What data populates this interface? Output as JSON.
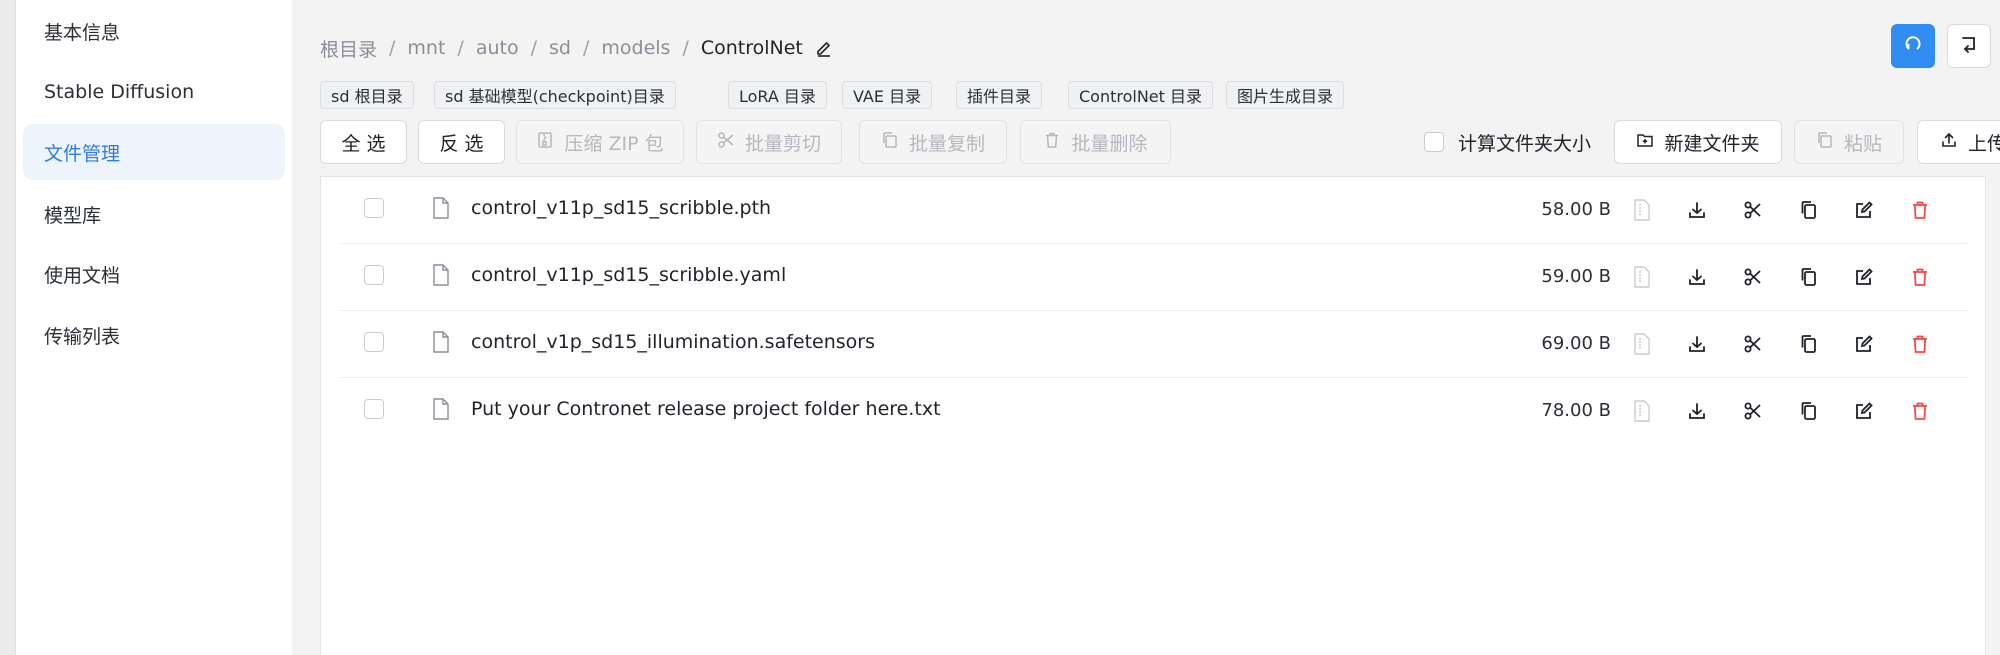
{
  "sidebar": {
    "items": [
      {
        "label": "基本信息"
      },
      {
        "label": "Stable Diffusion"
      },
      {
        "label": "文件管理"
      },
      {
        "label": "模型库"
      },
      {
        "label": "使用文档"
      },
      {
        "label": "传输列表"
      }
    ],
    "active_index": 2
  },
  "breadcrumb": {
    "items": [
      "根目录",
      "mnt",
      "auto",
      "sd",
      "models"
    ],
    "current": "ControlNet",
    "separator": "/"
  },
  "quick_dirs": [
    "sd 根目录",
    "sd 基础模型(checkpoint)目录",
    "LoRA 目录",
    "VAE 目录",
    "插件目录",
    "ControlNet 目录",
    "图片生成目录"
  ],
  "toolbar": {
    "select_all": "全 选",
    "invert_select": "反 选",
    "zip": "压缩 ZIP 包",
    "batch_cut": "批量剪切",
    "batch_copy": "批量复制",
    "batch_delete": "批量删除",
    "calc_folder_size": "计算文件夹大小",
    "new_folder": "新建文件夹",
    "paste": "粘贴",
    "upload": "上传"
  },
  "files": [
    {
      "name": "control_v11p_sd15_scribble.pth",
      "size": "58.00 B"
    },
    {
      "name": "control_v11p_sd15_scribble.yaml",
      "size": "59.00 B"
    },
    {
      "name": "control_v1p_sd15_illumination.safetensors",
      "size": "69.00 B"
    },
    {
      "name": "Put your Contronet release project folder here.txt",
      "size": "78.00 B"
    }
  ],
  "colors": {
    "accent": "#2f8cf0",
    "active_nav_bg": "#eef4fc",
    "delete_red": "#f5484a",
    "disabled_text": "#b5b8be"
  },
  "icons": {
    "refresh": "refresh-icon",
    "back": "return-icon",
    "edit": "edit-icon",
    "file": "file-icon",
    "preview": "file-preview-icon",
    "download": "download-icon",
    "cut": "scissors-icon",
    "copy": "copy-icon",
    "rename": "edit-icon",
    "delete": "trash-icon"
  }
}
